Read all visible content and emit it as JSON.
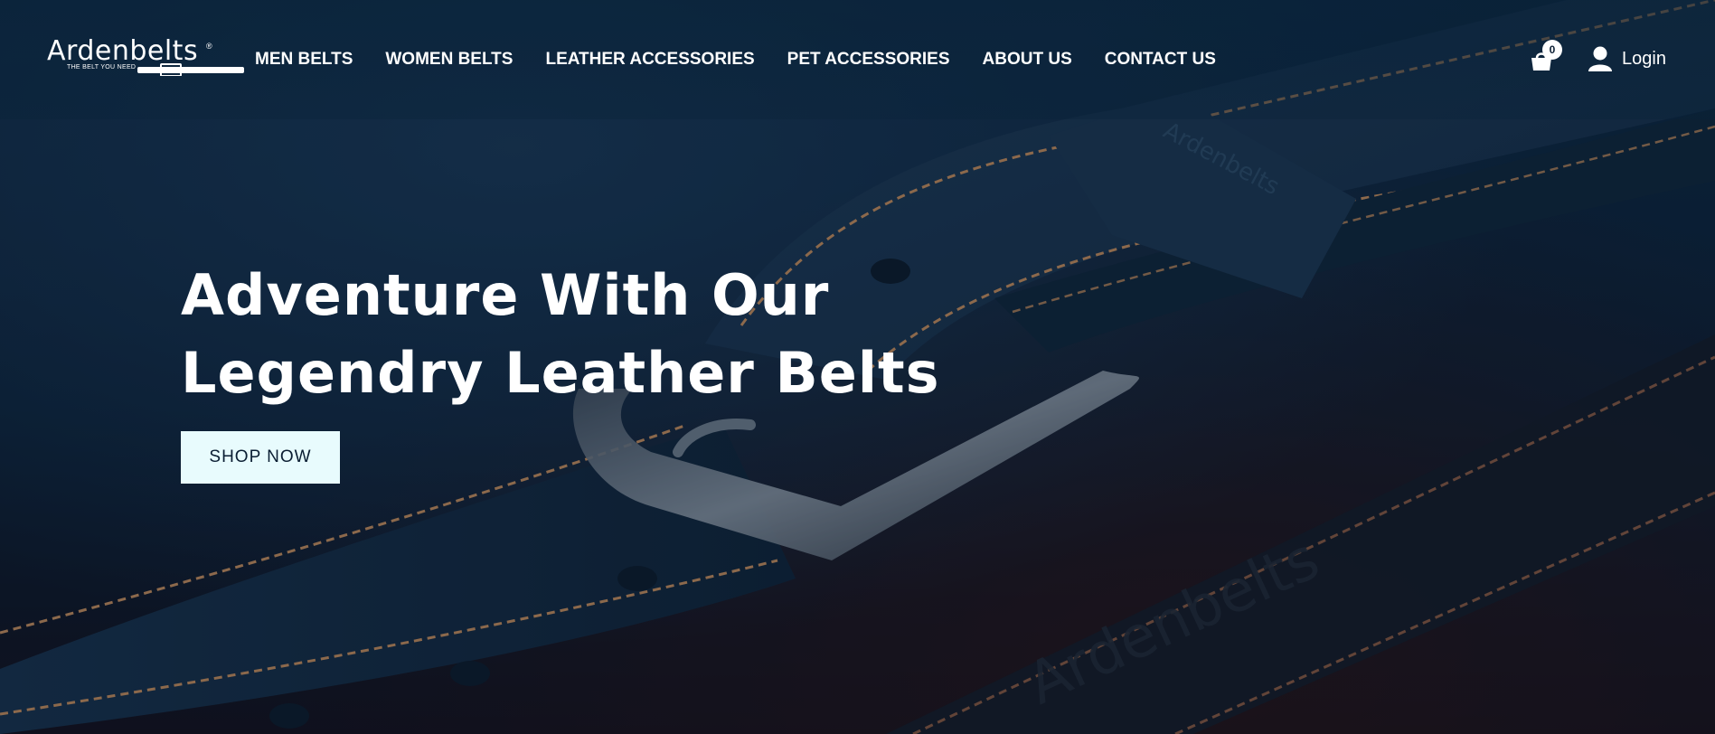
{
  "brand": {
    "logo_text": "Ardenbelts",
    "registered_mark": "®",
    "tagline": "THE BELT YOU NEED"
  },
  "nav": {
    "items": [
      {
        "label": "MEN BELTS"
      },
      {
        "label": "WOMEN BELTS"
      },
      {
        "label": "LEATHER ACCESSORIES"
      },
      {
        "label": "PET ACCESSORIES"
      },
      {
        "label": "ABOUT US"
      },
      {
        "label": "CONTACT US"
      }
    ]
  },
  "cart": {
    "icon": "shopping-bag-icon",
    "count": "0"
  },
  "account": {
    "icon": "user-icon",
    "login_label": "Login"
  },
  "hero": {
    "title_line1": "Adventure With Our",
    "title_line2": "Legendry Leather Belts",
    "cta_label": "SHOP NOW",
    "background_image": "navy leather belt with buckle, embossed Ardenbelts",
    "belt_emboss_text": "Ardenbelts"
  },
  "colors": {
    "background": "#0b1e33",
    "text": "#ffffff",
    "cta_background": "#e8fbfd",
    "cta_text": "#0b1e33",
    "stitching": "#c08a5a"
  }
}
